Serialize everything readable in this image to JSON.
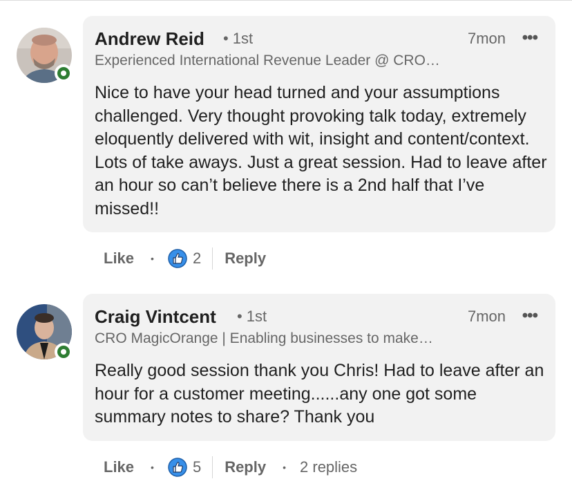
{
  "comments": [
    {
      "author": "Andrew Reid",
      "degree": "1st",
      "time": "7mon",
      "more_icon": "•••",
      "headline": "Experienced International Revenue Leader @ CRO…",
      "text": "Nice to have your head turned and your assumptions challenged. Very thought provoking talk today, extremely eloquently delivered with wit, insight and content/context. Lots of take aways. Just a great session. Had to leave after an hour so can’t believe there is a 2nd half that I’ve missed!!",
      "like_label": "Like",
      "reaction_count": "2",
      "reply_label": "Reply",
      "online": true
    },
    {
      "author": "Craig Vintcent",
      "degree": "1st",
      "time": "7mon",
      "more_icon": "•••",
      "headline": "CRO MagicOrange | Enabling businesses to make…",
      "text": "Really good session thank you Chris! Had to leave after an hour for a customer meeting......any one got some summary notes to share? Thank you",
      "like_label": "Like",
      "reaction_count": "5",
      "reply_label": "Reply",
      "replies_label": "2 replies",
      "online": true
    }
  ],
  "bullet": "•",
  "icons": {
    "reaction": "thumbs-up-icon",
    "presence": "online-status-icon",
    "more": "more-options-icon"
  },
  "colors": {
    "bubble": "#f2f2f2",
    "online": "#2e7d32",
    "like_blue": "#378fe9"
  }
}
